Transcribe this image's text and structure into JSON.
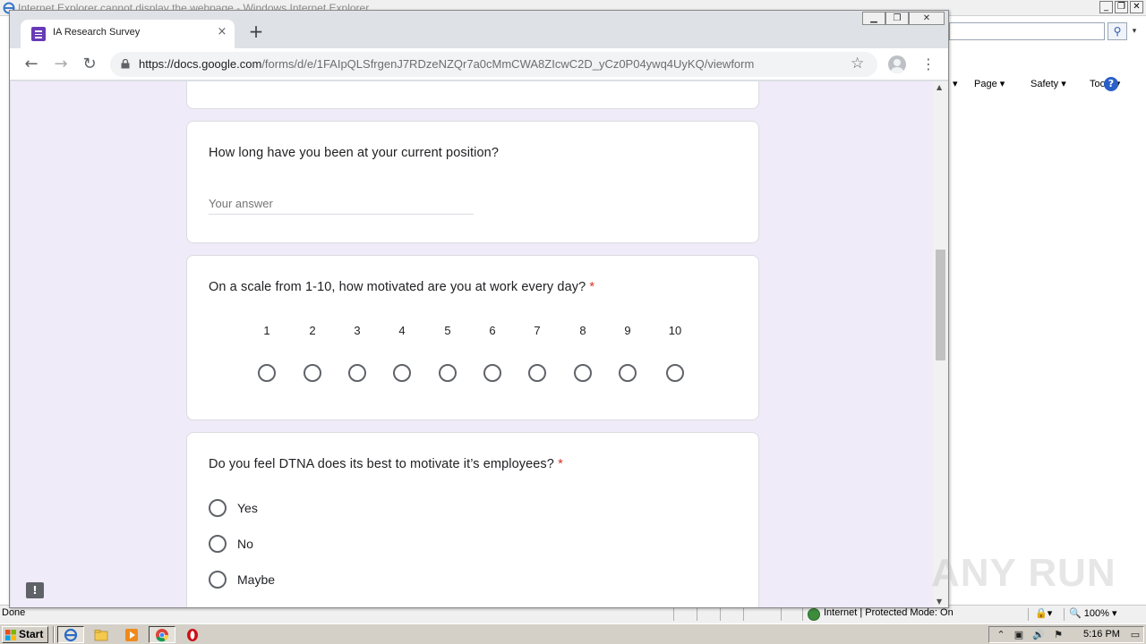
{
  "ie": {
    "title": "Internet Explorer cannot display the webpage - Windows Internet Explorer",
    "menu": {
      "page": "Page ▾",
      "safety": "Safety ▾",
      "tools": "Tools ▾",
      "help": "?"
    },
    "status": {
      "done": "Done",
      "zone": "Internet | Protected Mode: On",
      "zoom": "100%"
    }
  },
  "chrome": {
    "tab": {
      "title": "IA Research Survey",
      "close": "×"
    },
    "new_tab": "+",
    "url": {
      "host": "https://docs.google.com",
      "path": "/forms/d/e/1FAIpQLSfrgenJ7RDzeNZQr7a0cMmCWA8ZIcwC2D_yCz0P04ywq4UyKQ/viewform"
    }
  },
  "form": {
    "q_position": {
      "title": "How long have you been at your current position?",
      "placeholder": "Your answer"
    },
    "q_motivated": {
      "title": "On a scale from 1-10, how motivated are you at work every day?",
      "required": "*",
      "scale": [
        "1",
        "2",
        "3",
        "4",
        "5",
        "6",
        "7",
        "8",
        "9",
        "10"
      ]
    },
    "q_dtna": {
      "title": "Do you feel DTNA does its best to motivate it’s employees?",
      "required": "*",
      "options": [
        "Yes",
        "No",
        "Maybe"
      ]
    },
    "feedback": "!"
  },
  "watermark": "ANY RUN",
  "taskbar": {
    "start": "Start",
    "clock": "5:16 PM"
  }
}
